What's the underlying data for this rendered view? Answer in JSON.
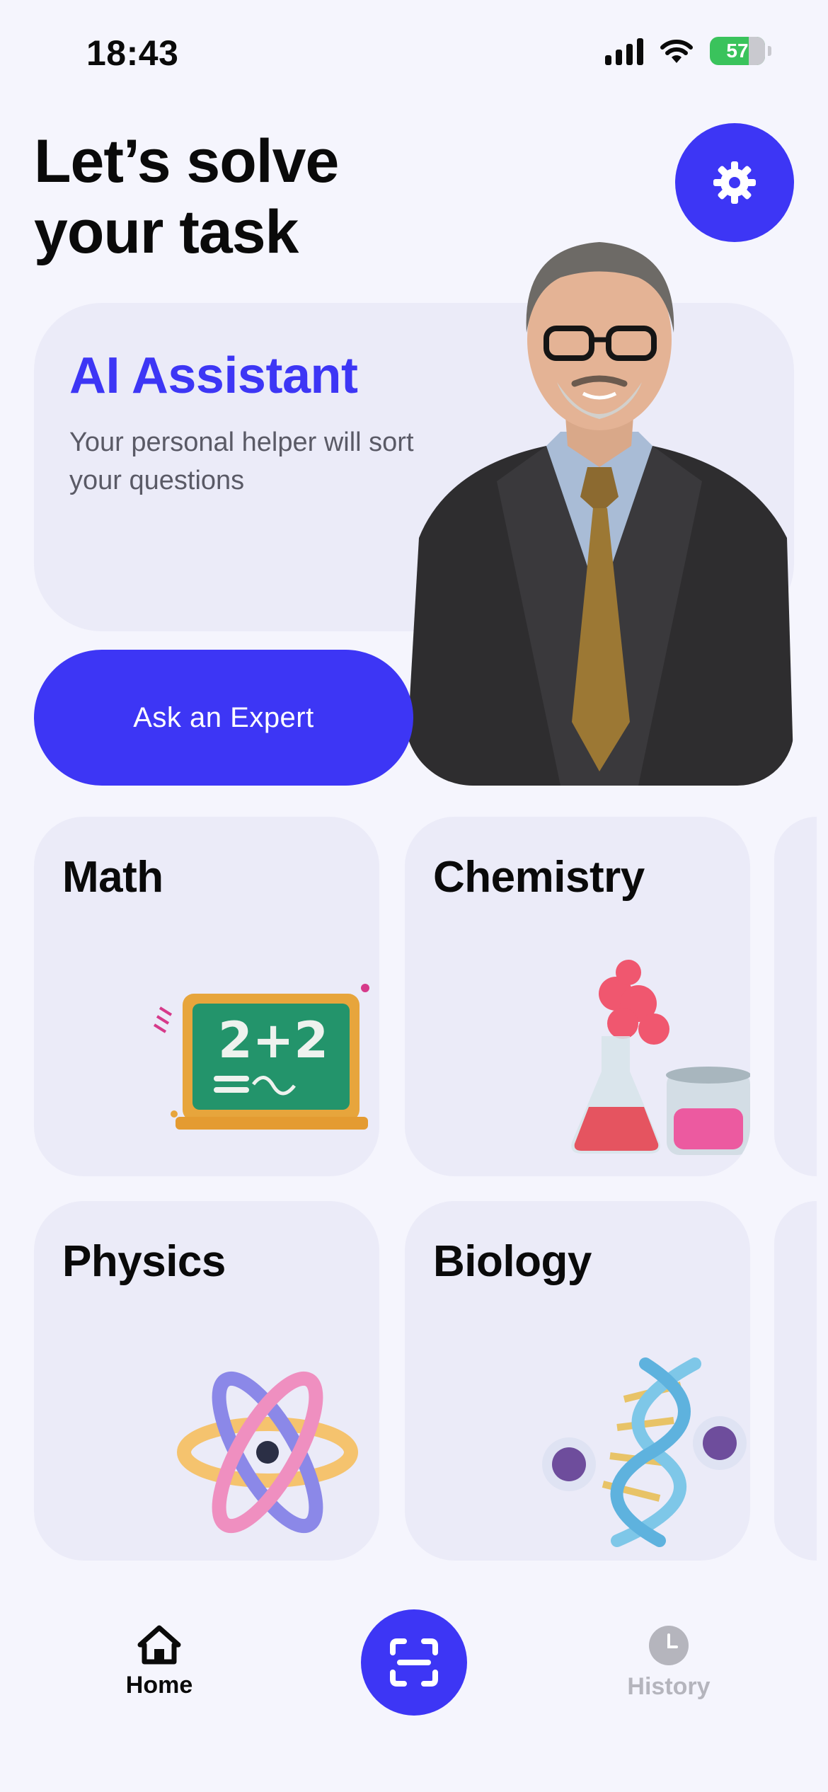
{
  "status_bar": {
    "time": "18:43",
    "battery": "57"
  },
  "header": {
    "title": "Let’s solve\nyour task"
  },
  "ai_card": {
    "title": "AI Assistant",
    "subtitle": "Your personal helper will sort your questions",
    "button_label": "Ask an Expert"
  },
  "subjects": [
    {
      "label": "Math"
    },
    {
      "label": "Chemistry"
    },
    {
      "label": "Physics"
    },
    {
      "label": "Biology"
    }
  ],
  "tabbar": {
    "home_label": "Home",
    "history_label": "History"
  },
  "colors": {
    "accent": "#3d36f5",
    "card": "#ebebf8",
    "background": "#f5f5fd",
    "inactive": "#b5b5bd"
  }
}
